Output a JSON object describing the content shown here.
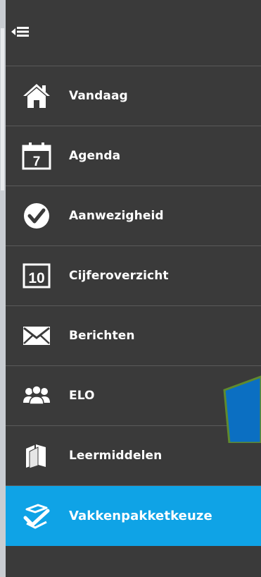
{
  "sidebar": {
    "collapse_icon": "collapse-menu-icon",
    "items": [
      {
        "label": "Vandaag",
        "icon": "home-icon",
        "active": false
      },
      {
        "label": "Agenda",
        "icon": "calendar-icon",
        "icon_text": "7",
        "active": false
      },
      {
        "label": "Aanwezigheid",
        "icon": "checkmark-icon",
        "active": false
      },
      {
        "label": "Cijferoverzicht",
        "icon": "grades-icon",
        "icon_text": "10",
        "active": false
      },
      {
        "label": "Berichten",
        "icon": "envelope-icon",
        "active": false
      },
      {
        "label": "ELO",
        "icon": "users-group-icon",
        "active": false,
        "has_submenu": true
      },
      {
        "label": "Leermiddelen",
        "icon": "books-icon",
        "active": false
      },
      {
        "label": "Vakkenpakketkeuze",
        "icon": "checklist-icon",
        "active": true
      }
    ]
  },
  "colors": {
    "sidebar_bg": "#3a3a3a",
    "active_bg": "#0fa3e6",
    "annotation_arrow_fill": "#0b6fc2",
    "annotation_arrow_stroke": "#5f8a2e"
  }
}
